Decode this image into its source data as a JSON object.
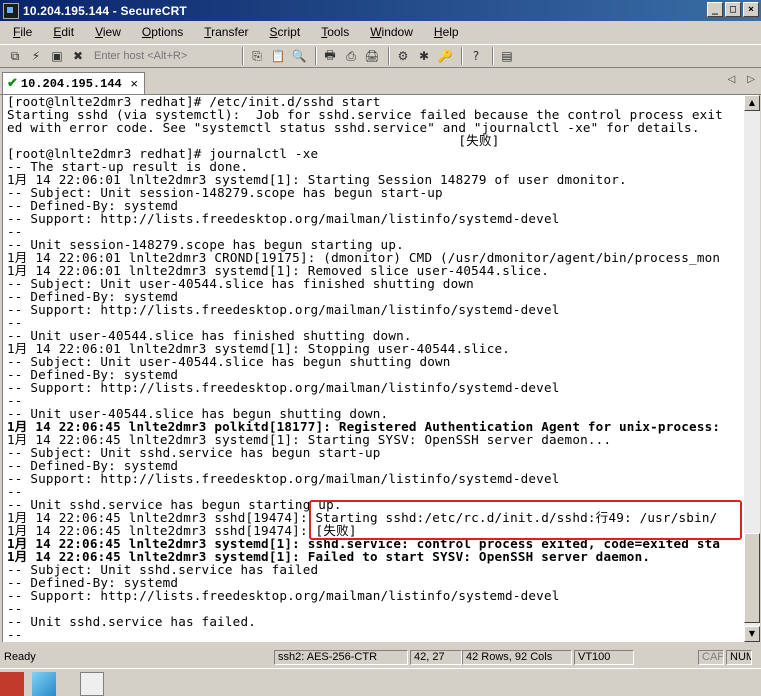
{
  "window": {
    "title": "10.204.195.144 - SecureCRT"
  },
  "menu": [
    "File",
    "Edit",
    "View",
    "Options",
    "Transfer",
    "Script",
    "Tools",
    "Window",
    "Help"
  ],
  "toolbar": {
    "host_placeholder": "Enter host <Alt+R>"
  },
  "tab": {
    "label": "10.204.195.144",
    "close": "×"
  },
  "terminal": {
    "lines": [
      "[root@lnlte2dmr3 redhat]# /etc/init.d/sshd start",
      "Starting sshd (via systemctl):  Job for sshd.service failed because the control process exit",
      "ed with error code. See \"systemctl status sshd.service\" and \"journalctl -xe\" for details.",
      "                                                          [失败]",
      "[root@lnlte2dmr3 redhat]# journalctl -xe",
      "-- The start-up result is done.",
      "1月 14 22:06:01 lnlte2dmr3 systemd[1]: Starting Session 148279 of user dmonitor.",
      "-- Subject: Unit session-148279.scope has begun start-up",
      "-- Defined-By: systemd",
      "-- Support: http://lists.freedesktop.org/mailman/listinfo/systemd-devel",
      "--",
      "-- Unit session-148279.scope has begun starting up.",
      "1月 14 22:06:01 lnlte2dmr3 CROND[19175]: (dmonitor) CMD (/usr/dmonitor/agent/bin/process_mon",
      "1月 14 22:06:01 lnlte2dmr3 systemd[1]: Removed slice user-40544.slice.",
      "-- Subject: Unit user-40544.slice has finished shutting down",
      "-- Defined-By: systemd",
      "-- Support: http://lists.freedesktop.org/mailman/listinfo/systemd-devel",
      "--",
      "-- Unit user-40544.slice has finished shutting down.",
      "1月 14 22:06:01 lnlte2dmr3 systemd[1]: Stopping user-40544.slice.",
      "-- Subject: Unit user-40544.slice has begun shutting down",
      "-- Defined-By: systemd",
      "-- Support: http://lists.freedesktop.org/mailman/listinfo/systemd-devel",
      "--",
      "-- Unit user-40544.slice has begun shutting down.",
      "1月 14 22:06:45 lnlte2dmr3 polkitd[18177]: Registered Authentication Agent for unix-process:",
      "1月 14 22:06:45 lnlte2dmr3 systemd[1]: Starting SYSV: OpenSSH server daemon...",
      "-- Subject: Unit sshd.service has begun start-up",
      "-- Defined-By: systemd",
      "-- Support: http://lists.freedesktop.org/mailman/listinfo/systemd-devel",
      "--",
      "-- Unit sshd.service has begun starting up.",
      "1月 14 22:06:45 lnlte2dmr3 sshd[19474]: Starting sshd:/etc/rc.d/init.d/sshd:行49: /usr/sbin/",
      "1月 14 22:06:45 lnlte2dmr3 sshd[19474]: [失败]",
      "1月 14 22:06:45 lnlte2dmr3 systemd[1]: sshd.service: control process exited, code=exited sta",
      "1月 14 22:06:45 lnlte2dmr3 systemd[1]: Failed to start SYSV: OpenSSH server daemon.",
      "-- Subject: Unit sshd.service has failed",
      "-- Defined-By: systemd",
      "-- Support: http://lists.freedesktop.org/mailman/listinfo/systemd-devel",
      "--",
      "-- Unit sshd.service has failed.",
      "--"
    ],
    "bold_lines": [
      25,
      34,
      35
    ]
  },
  "status": {
    "ready": "Ready",
    "cipher": "ssh2: AES-256-CTR",
    "cursor": "42,  27",
    "size": "42 Rows, 92 Cols",
    "emulation": "VT100",
    "cap": "CAP",
    "num": "NUM"
  },
  "accent": {
    "highlight": "#e02020",
    "title_bg": "#0a246a"
  }
}
